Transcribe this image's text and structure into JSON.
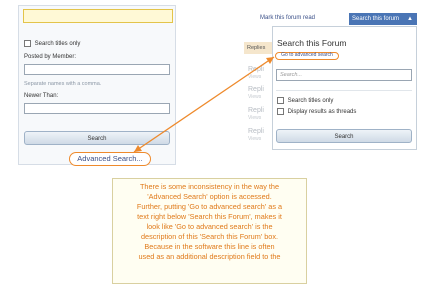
{
  "left_form": {
    "checkbox_label": "Search titles only",
    "posted_by_label": "Posted by Member:",
    "hint": "Separate names with a comma.",
    "newer_than_label": "Newer Than:",
    "search_button": "Search",
    "advanced_link": "Advanced Search..."
  },
  "right_panel": {
    "mark_read_link": "Mark this forum read",
    "tab_label": "Search this forum",
    "background_tab": "Replies",
    "background_items": [
      {
        "title": "Repli",
        "sub": "Views"
      },
      {
        "title": "Repli",
        "sub": "Views"
      },
      {
        "title": "Repli",
        "sub": "Views"
      },
      {
        "title": "Repli",
        "sub": "Views"
      }
    ],
    "dropdown": {
      "title": "Search this Forum",
      "goto_link": "Go to advanced search",
      "search_placeholder": "Search...",
      "option_titles": "Search titles only",
      "option_threads": "Display results as threads",
      "search_button": "Search"
    }
  },
  "annotation": {
    "lines": [
      "There is some inconsistency in the way the",
      "'Advanced Search' option is accessed.",
      "Further, putting 'Go to advanced search' as a",
      "text right below 'Search this Forum', makes it",
      "look like 'Go to advanced search' is the",
      "description of this 'Search this Forum' box.",
      "Because in the software this line is often",
      "used as an additional description field to the"
    ]
  },
  "colors": {
    "annotation_text": "#e07a1a",
    "highlight": "#ee8a2c",
    "tab_bg": "#4a75b5"
  }
}
